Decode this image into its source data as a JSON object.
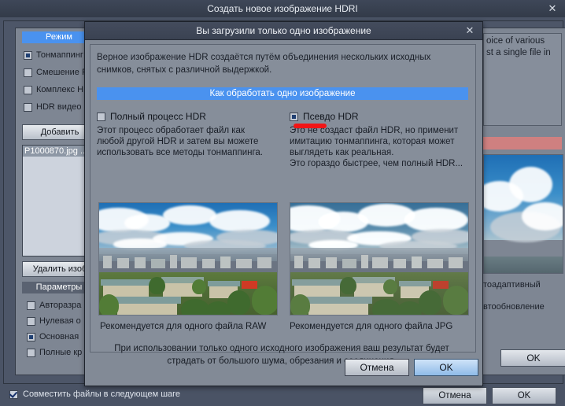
{
  "app_window": {
    "title": "Создать новое изображение HDRI",
    "close_icon": "close-icon",
    "left_panel": {
      "mode_header": "Режим",
      "mode_options": [
        {
          "label": "Тонмаппинг",
          "type": "radio",
          "selected": true
        },
        {
          "label": "Смешение F",
          "type": "checkbox",
          "selected": false
        },
        {
          "label": "Комплекс H",
          "type": "checkbox",
          "selected": false
        },
        {
          "label": "HDR видео",
          "type": "checkbox",
          "selected": false
        }
      ],
      "add_button": "Добавить",
      "file_list": [
        "P1000870.jpg ..."
      ],
      "delete_button": "Удалить изоб",
      "params_header": "Параметры",
      "param_options": [
        {
          "label": "Авторазра",
          "type": "checkbox",
          "selected": false
        },
        {
          "label": "Нулевая о",
          "type": "checkbox",
          "selected": false
        },
        {
          "label": "Основная",
          "type": "radio",
          "selected": true
        },
        {
          "label": "Полные кр",
          "type": "checkbox",
          "selected": false
        }
      ]
    },
    "right_panel": {
      "info_text_line1": "oice of various",
      "info_text_line2": "st a single file in",
      "label_autoadaptive": "тоадаптивный",
      "label_autoupdate": "втообновление",
      "ok_button": "OK"
    },
    "bottom_bar": {
      "merge_checkbox_label": "Совместить файлы в следующем шаге",
      "merge_checkbox_checked": true,
      "cancel_button": "Отмена",
      "ok_button": "OK"
    }
  },
  "modal": {
    "title": "Вы загрузили только одно изображение",
    "close_icon": "close-icon",
    "intro": "Верное изображение HDR создаётся путём объединения нескольких исходных снимков, снятых с различной выдержкой.",
    "banner": "Как обработать одно изображение",
    "options": [
      {
        "label": "Полный процесс HDR",
        "selected": false,
        "type": "checkbox",
        "description": "Этот процесс обработает файл как\nлюбой другой HDR и затем вы можете\nиспользовать все методы тонмаппинга.",
        "caption": "Рекомендуется для одного файла RAW",
        "highlighted": false
      },
      {
        "label": "Псевдо HDR",
        "selected": true,
        "type": "radio",
        "description": "Это не создаст файл HDR, но применит\nимитацию тонмаппинга, которая может\nвыглядеть как реальная.\nЭто гораздо быстрее, чем полный HDR...",
        "caption": "Рекомендуется для одного файла JPG",
        "highlighted": true
      }
    ],
    "warning": "При использовании только одного исходного изображения ваш результат будет страдать от большого шума, обрезания и соединения.",
    "cancel_button": "Отмена",
    "ok_button": "OK"
  },
  "colors": {
    "accent_blue": "#4a92ef",
    "highlight_red": "#f21515",
    "title_bar": "#3e4758",
    "dialog_bg": "#868e9a",
    "app_bg": "#4a5365",
    "pink_bar": "#cf8080"
  }
}
